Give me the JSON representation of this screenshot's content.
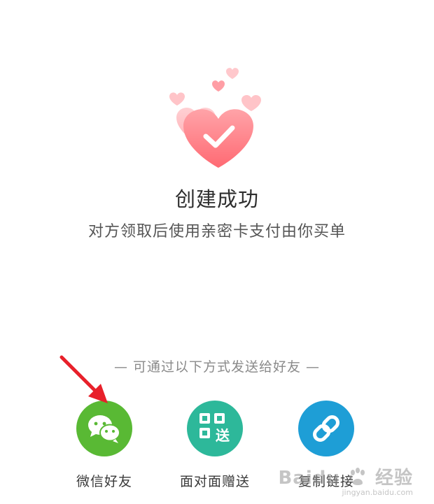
{
  "success": {
    "title": "创建成功",
    "subtitle": "对方领取后使用亲密卡支付由你买单"
  },
  "share": {
    "hint": "— 可通过以下方式发送给好友 —",
    "options": [
      {
        "label": "微信好友",
        "icon": "wechat-icon",
        "color": "#59b934"
      },
      {
        "label": "面对面赠送",
        "icon": "qr-send-icon",
        "color": "#2db89a",
        "icon_text": "送"
      },
      {
        "label": "复制链接",
        "icon": "link-icon",
        "color": "#1e9ed6"
      }
    ]
  },
  "watermark": {
    "brand": "Baidu",
    "name": "经验",
    "url": "jingyan.baidu.com"
  },
  "colors": {
    "heart_main": "#ff7f86",
    "heart_light": "#ffc2c6",
    "annotation_arrow": "#e8202a"
  }
}
